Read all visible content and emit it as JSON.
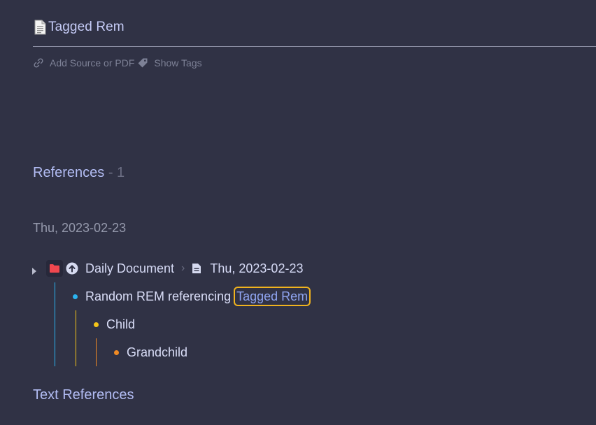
{
  "document": {
    "title": "Tagged Rem",
    "icon": "document-emoji-icon"
  },
  "meta": {
    "add_source_label": "Add Source or PDF",
    "show_tags_label": "Show Tags"
  },
  "references": {
    "heading": "References",
    "count": " - 1",
    "groups": [
      {
        "date": "Thu, 2023-02-23",
        "breadcrumb": {
          "parent": "Daily Document",
          "separator": "›",
          "page": "Thu, 2023-02-23"
        },
        "rems": [
          {
            "text": "Random REM referencing",
            "reference": "Tagged Rem",
            "bullet_color": "#2bb4f0"
          },
          {
            "text": "Child",
            "bullet_color": "#f5c518"
          },
          {
            "text": "Grandchild",
            "bullet_color": "#f08a24"
          }
        ]
      }
    ]
  },
  "text_references": {
    "heading": "Text References"
  },
  "colors": {
    "background": "#303245",
    "accent_link": "#8fa4f0",
    "highlight_border": "#f0b31e",
    "folder_red": "#f0474f"
  }
}
